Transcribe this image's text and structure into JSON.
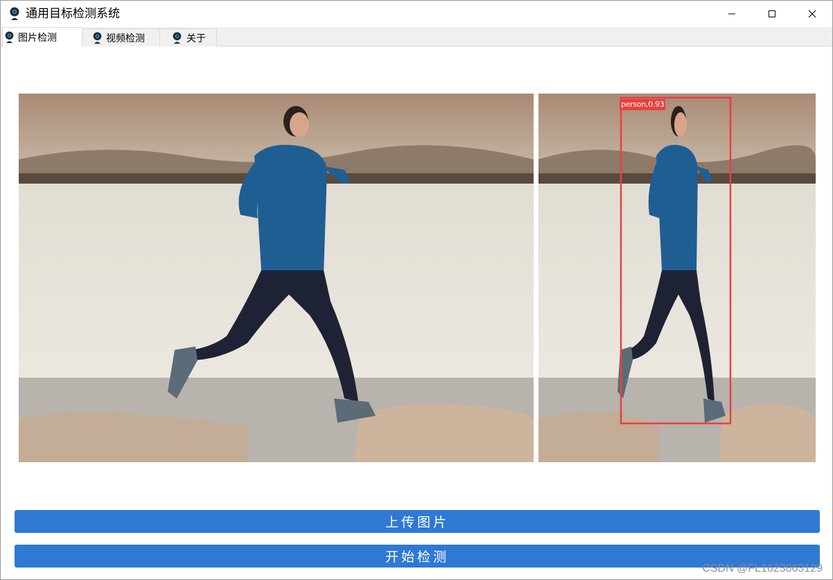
{
  "window": {
    "title": "通用目标检测系统",
    "icon": "webcam-icon",
    "controls": [
      "minimize-icon",
      "maximize-icon",
      "close-icon"
    ]
  },
  "tabs": [
    {
      "label": "图片检测",
      "icon": "webcam-icon",
      "active": true
    },
    {
      "label": "视频检测",
      "icon": "webcam-icon",
      "active": false
    },
    {
      "label": "关于",
      "icon": "webcam-icon",
      "active": false
    }
  ],
  "panels": {
    "original": {
      "description_icon": "photo-runner-original"
    },
    "result": {
      "detection_label": "person,0.93",
      "box_color": "#ec3e3e"
    }
  },
  "buttons": {
    "upload_label": "上传图片",
    "detect_label": "开始检测"
  },
  "watermark": "CSDN @FL1623863129",
  "colors": {
    "accent": "#2f79d4",
    "detection": "#ec3e3e",
    "tab_bg": "#f0f0f0"
  }
}
